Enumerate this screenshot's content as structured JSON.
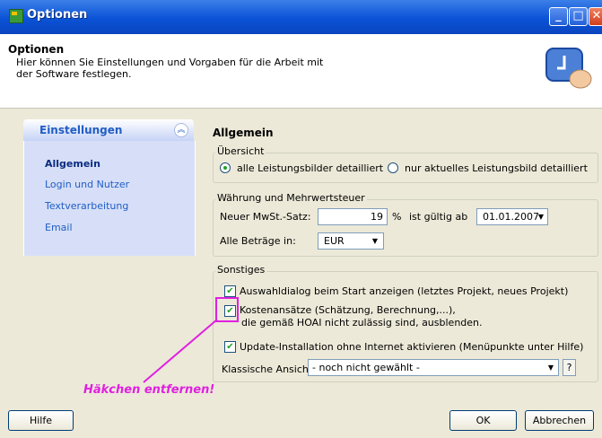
{
  "window": {
    "title": "Optionen"
  },
  "header": {
    "title": "Optionen",
    "description": "Hier können Sie Einstellungen und Vorgaben für die Arbeit mit der Software festlegen."
  },
  "sidebar": {
    "header": "Einstellungen",
    "items": [
      {
        "label": "Allgemein",
        "active": true
      },
      {
        "label": "Login und Nutzer",
        "active": false
      },
      {
        "label": "Textverarbeitung",
        "active": false
      },
      {
        "label": "Email",
        "active": false
      }
    ]
  },
  "main": {
    "title": "Allgemein",
    "overview": {
      "legend": "Übersicht",
      "options": [
        {
          "label": "alle Leistungsbilder detailliert",
          "selected": true
        },
        {
          "label": "nur aktuelles Leistungsbild detailliert",
          "selected": false
        }
      ]
    },
    "currency": {
      "legend": "Währung und Mehrwertsteuer",
      "vat_label": "Neuer MwSt.-Satz:",
      "vat_value": "19",
      "percent": "%",
      "valid_from_label": "ist gültig ab",
      "valid_from_value": "01.01.2007",
      "amounts_label": "Alle Beträge in:",
      "currency_value": "EUR"
    },
    "misc": {
      "legend": "Sonstiges",
      "checkboxes": [
        {
          "label": "Auswahldialog beim Start anzeigen (letztes Projekt, neues Projekt)",
          "checked": true
        },
        {
          "label": "Kostenansätze (Schätzung, Berechnung,...),",
          "label2": "die gemäß HOAI nicht zulässig sind, ausblenden.",
          "checked": true
        },
        {
          "label": "Update-Installation ohne Internet aktivieren (Menüpunkte unter Hilfe)",
          "checked": true
        }
      ],
      "classic_view_label": "Klassische Ansicht:",
      "classic_view_value": "- noch nicht gewählt -",
      "help_label": "?"
    }
  },
  "annotation": {
    "text": "Häkchen entfernen!",
    "color": "#e020e0"
  },
  "footer": {
    "help": "Hilfe",
    "ok": "OK",
    "cancel": "Abbrechen"
  },
  "colors": {
    "titlebar": "#0a52d6",
    "sidebar": "#d6dff7",
    "panel": "#ece9d8",
    "link": "#215dc6"
  }
}
